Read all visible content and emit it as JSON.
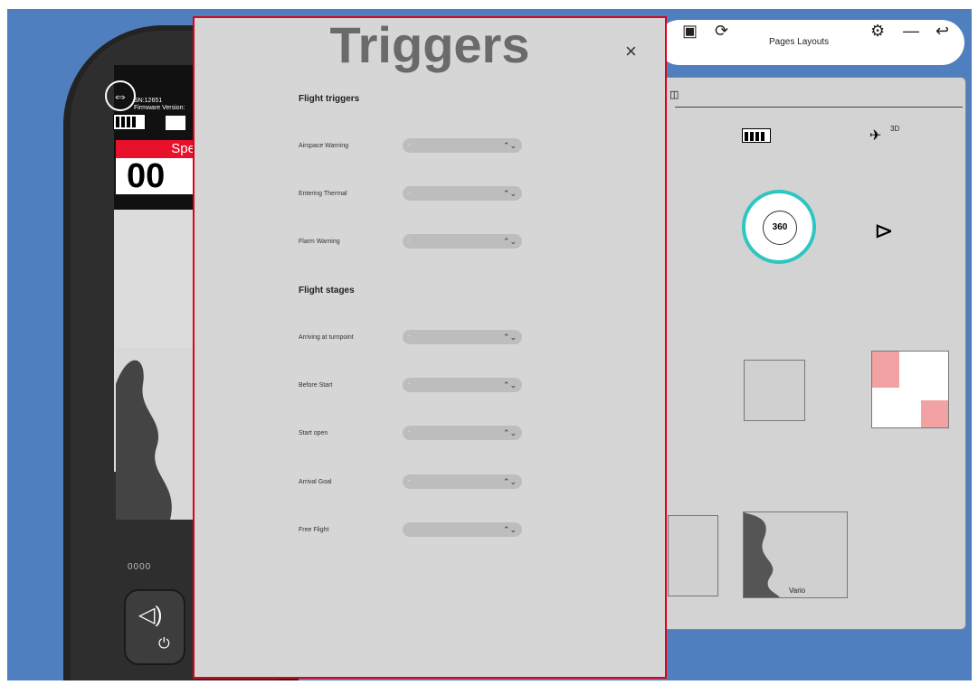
{
  "device": {
    "serial": "SN:12651",
    "firmware": "Firmware Version:",
    "speed_label": "Spe",
    "speed_value": "00",
    "dots": "0000"
  },
  "toolbar": {
    "pages_layouts_label": "Pages Layouts",
    "icons": [
      "auto-icon",
      "rotate-icon",
      "settings-icon",
      "minimize-icon",
      "back-icon"
    ]
  },
  "tiles": {
    "compass_value": "360",
    "vario_label": "Vario",
    "satellite_label": "3D"
  },
  "modal": {
    "title": "Triggers",
    "close_label": "×",
    "sections": [
      {
        "heading": "Flight triggers",
        "items": [
          {
            "label": "Airspace Warning",
            "value": "-"
          },
          {
            "label": "Entering Thermal",
            "value": "-"
          },
          {
            "label": "Flarm Warning",
            "value": "-"
          }
        ]
      },
      {
        "heading": "Flight stages",
        "items": [
          {
            "label": "Arriving at turnpoint",
            "value": "-"
          },
          {
            "label": "Before Start",
            "value": "-"
          },
          {
            "label": "Start open",
            "value": "-"
          },
          {
            "label": "Arrival Goal",
            "value": "-"
          },
          {
            "label": "Free Flight",
            "value": ""
          }
        ]
      }
    ]
  },
  "colors": {
    "background": "#4f7fbe",
    "accent_red": "#e00018",
    "modal_bg": "#d6d6d6"
  }
}
